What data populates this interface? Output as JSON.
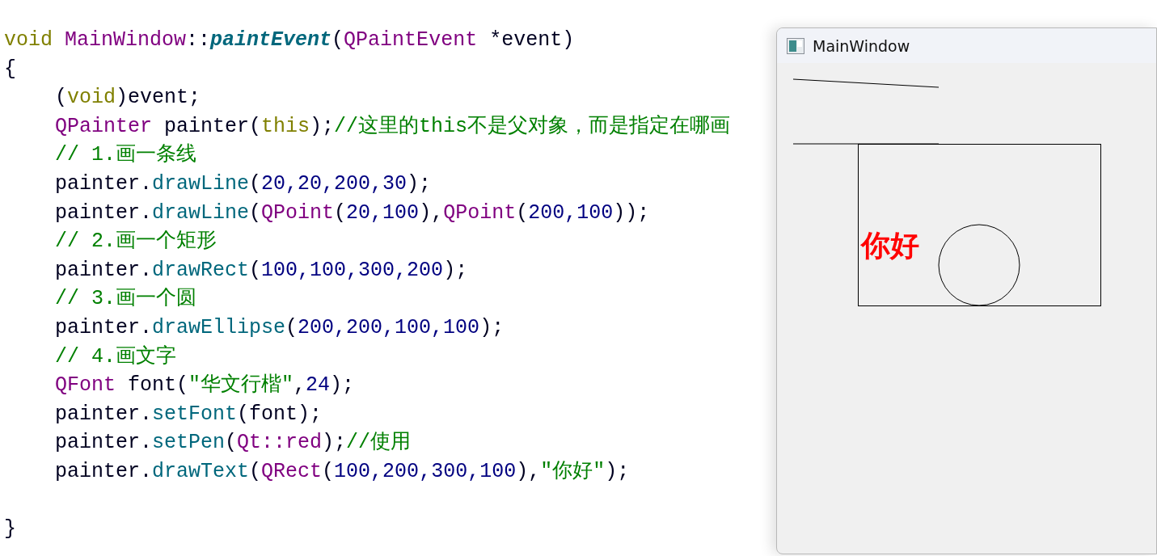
{
  "editor": {
    "lines": [
      {
        "indented": false,
        "tokens": [
          {
            "kind": "kw",
            "text": "void"
          },
          {
            "kind": "type",
            "text": " MainWindow"
          },
          {
            "kind": "plain",
            "text": "::"
          },
          {
            "kind": "fn_def",
            "text": "paintEvent"
          },
          {
            "kind": "plain",
            "text": "("
          },
          {
            "kind": "type",
            "text": "QPaintEvent"
          },
          {
            "kind": "plain",
            "text": " *event)"
          }
        ]
      },
      {
        "indented": false,
        "tokens": [
          {
            "kind": "plain",
            "text": "{"
          }
        ]
      },
      {
        "indented": true,
        "tokens": [
          {
            "kind": "plain",
            "text": "("
          },
          {
            "kind": "kw",
            "text": "void"
          },
          {
            "kind": "plain",
            "text": ")event;"
          }
        ]
      },
      {
        "indented": true,
        "tokens": [
          {
            "kind": "type",
            "text": "QPainter"
          },
          {
            "kind": "plain",
            "text": " painter("
          },
          {
            "kind": "kw",
            "text": "this"
          },
          {
            "kind": "plain",
            "text": ");"
          },
          {
            "kind": "comment",
            "text": "//这里的this不是父对象，而是指定在哪画"
          }
        ]
      },
      {
        "indented": true,
        "tokens": [
          {
            "kind": "comment",
            "text": "// 1.画一条线"
          }
        ]
      },
      {
        "indented": true,
        "tokens": [
          {
            "kind": "plain",
            "text": "painter."
          },
          {
            "kind": "fn",
            "text": "drawLine"
          },
          {
            "kind": "plain",
            "text": "("
          },
          {
            "kind": "num",
            "text": "20,20,200,30"
          },
          {
            "kind": "plain",
            "text": ");"
          }
        ]
      },
      {
        "indented": true,
        "tokens": [
          {
            "kind": "plain",
            "text": "painter."
          },
          {
            "kind": "fn",
            "text": "drawLine"
          },
          {
            "kind": "plain",
            "text": "("
          },
          {
            "kind": "type",
            "text": "QPoint"
          },
          {
            "kind": "plain",
            "text": "("
          },
          {
            "kind": "num",
            "text": "20,100"
          },
          {
            "kind": "plain",
            "text": "),"
          },
          {
            "kind": "type",
            "text": "QPoint"
          },
          {
            "kind": "plain",
            "text": "("
          },
          {
            "kind": "num",
            "text": "200,100"
          },
          {
            "kind": "plain",
            "text": "));"
          }
        ]
      },
      {
        "indented": true,
        "tokens": [
          {
            "kind": "comment",
            "text": "// 2.画一个矩形"
          }
        ]
      },
      {
        "indented": true,
        "tokens": [
          {
            "kind": "plain",
            "text": "painter."
          },
          {
            "kind": "fn",
            "text": "drawRect"
          },
          {
            "kind": "plain",
            "text": "("
          },
          {
            "kind": "num",
            "text": "100,100,300,200"
          },
          {
            "kind": "plain",
            "text": ");"
          }
        ]
      },
      {
        "indented": true,
        "tokens": [
          {
            "kind": "comment",
            "text": "// 3.画一个圆"
          }
        ]
      },
      {
        "indented": true,
        "tokens": [
          {
            "kind": "plain",
            "text": "painter."
          },
          {
            "kind": "fn",
            "text": "drawEllipse"
          },
          {
            "kind": "plain",
            "text": "("
          },
          {
            "kind": "num",
            "text": "200,200,100,100"
          },
          {
            "kind": "plain",
            "text": ");"
          }
        ]
      },
      {
        "indented": true,
        "tokens": [
          {
            "kind": "comment",
            "text": "// 4.画文字"
          }
        ]
      },
      {
        "indented": true,
        "tokens": [
          {
            "kind": "type",
            "text": "QFont"
          },
          {
            "kind": "plain",
            "text": " font("
          },
          {
            "kind": "str",
            "text": "\"华文行楷\""
          },
          {
            "kind": "plain",
            "text": ","
          },
          {
            "kind": "num",
            "text": "24"
          },
          {
            "kind": "plain",
            "text": ");"
          }
        ]
      },
      {
        "indented": true,
        "tokens": [
          {
            "kind": "plain",
            "text": "painter."
          },
          {
            "kind": "fn",
            "text": "setFont"
          },
          {
            "kind": "plain",
            "text": "(font);"
          }
        ]
      },
      {
        "indented": true,
        "tokens": [
          {
            "kind": "plain",
            "text": "painter."
          },
          {
            "kind": "fn",
            "text": "setPen"
          },
          {
            "kind": "plain",
            "text": "("
          },
          {
            "kind": "type",
            "text": "Qt::red"
          },
          {
            "kind": "plain",
            "text": ");"
          },
          {
            "kind": "comment",
            "text": "//使用"
          }
        ]
      },
      {
        "indented": true,
        "tokens": [
          {
            "kind": "plain",
            "text": "painter."
          },
          {
            "kind": "fn",
            "text": "drawText"
          },
          {
            "kind": "plain",
            "text": "("
          },
          {
            "kind": "type",
            "text": "QRect"
          },
          {
            "kind": "plain",
            "text": "("
          },
          {
            "kind": "num",
            "text": "100,200,300,100"
          },
          {
            "kind": "plain",
            "text": "),"
          },
          {
            "kind": "str",
            "text": "\"你好\""
          },
          {
            "kind": "plain",
            "text": ");"
          }
        ]
      },
      {
        "indented": false,
        "blank_before": true,
        "tokens": [
          {
            "kind": "plain",
            "text": "}"
          }
        ]
      }
    ]
  },
  "window": {
    "title": "MainWindow",
    "canvas": {
      "text": "你好"
    }
  }
}
